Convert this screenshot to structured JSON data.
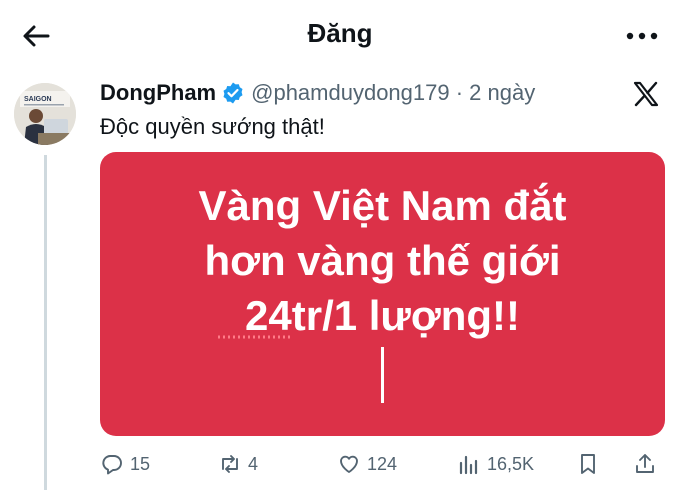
{
  "header": {
    "title": "Đăng"
  },
  "tweet": {
    "author_name": "DongPham",
    "handle_meta": "@phamduydong179 · 2 ngày",
    "text": "Độc quyền sướng thật!",
    "card_lines": [
      "Vàng Việt Nam đắt",
      "hơn vàng thế giới",
      "24tr/1 lượng!!"
    ],
    "avatar_sign_text": "SAIGON"
  },
  "actions": {
    "replies": "15",
    "reposts": "4",
    "likes": "124",
    "views": "16,5K"
  },
  "colors": {
    "card_bg": "#dc3148",
    "verified": "#1d9bf0",
    "muted": "#536471",
    "thread_line": "#cfd9de"
  },
  "icons": [
    "back-arrow-icon",
    "more-icon",
    "verified-icon",
    "x-logo-icon",
    "reply-icon",
    "repost-icon",
    "like-icon",
    "views-icon",
    "bookmark-icon",
    "share-icon"
  ]
}
